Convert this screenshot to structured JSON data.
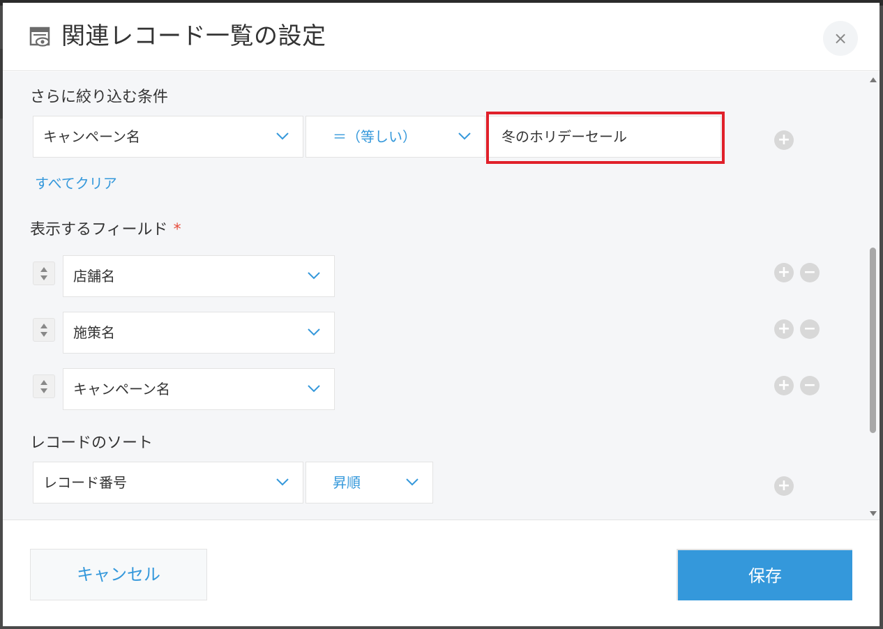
{
  "dialog": {
    "title": "関連レコード一覧の設定",
    "close_label": "×"
  },
  "filter": {
    "label": "さらに絞り込む条件",
    "field": "キャンペーン名",
    "operator": "＝（等しい）",
    "value": "冬のホリデーセール",
    "clear_all": "すべてクリア"
  },
  "display_fields": {
    "label": "表示するフィールド",
    "required_mark": "*",
    "items": [
      {
        "label": "店舗名"
      },
      {
        "label": "施策名"
      },
      {
        "label": "キャンペーン名"
      }
    ]
  },
  "sort": {
    "label": "レコードのソート",
    "field": "レコード番号",
    "order": "昇順"
  },
  "footer": {
    "cancel_label": "キャンセル",
    "save_label": "保存"
  },
  "icons": {
    "plus": "+",
    "minus": "−"
  },
  "colors": {
    "accent": "#3498db",
    "highlight": "#e0202a",
    "required": "#e74c3c"
  }
}
